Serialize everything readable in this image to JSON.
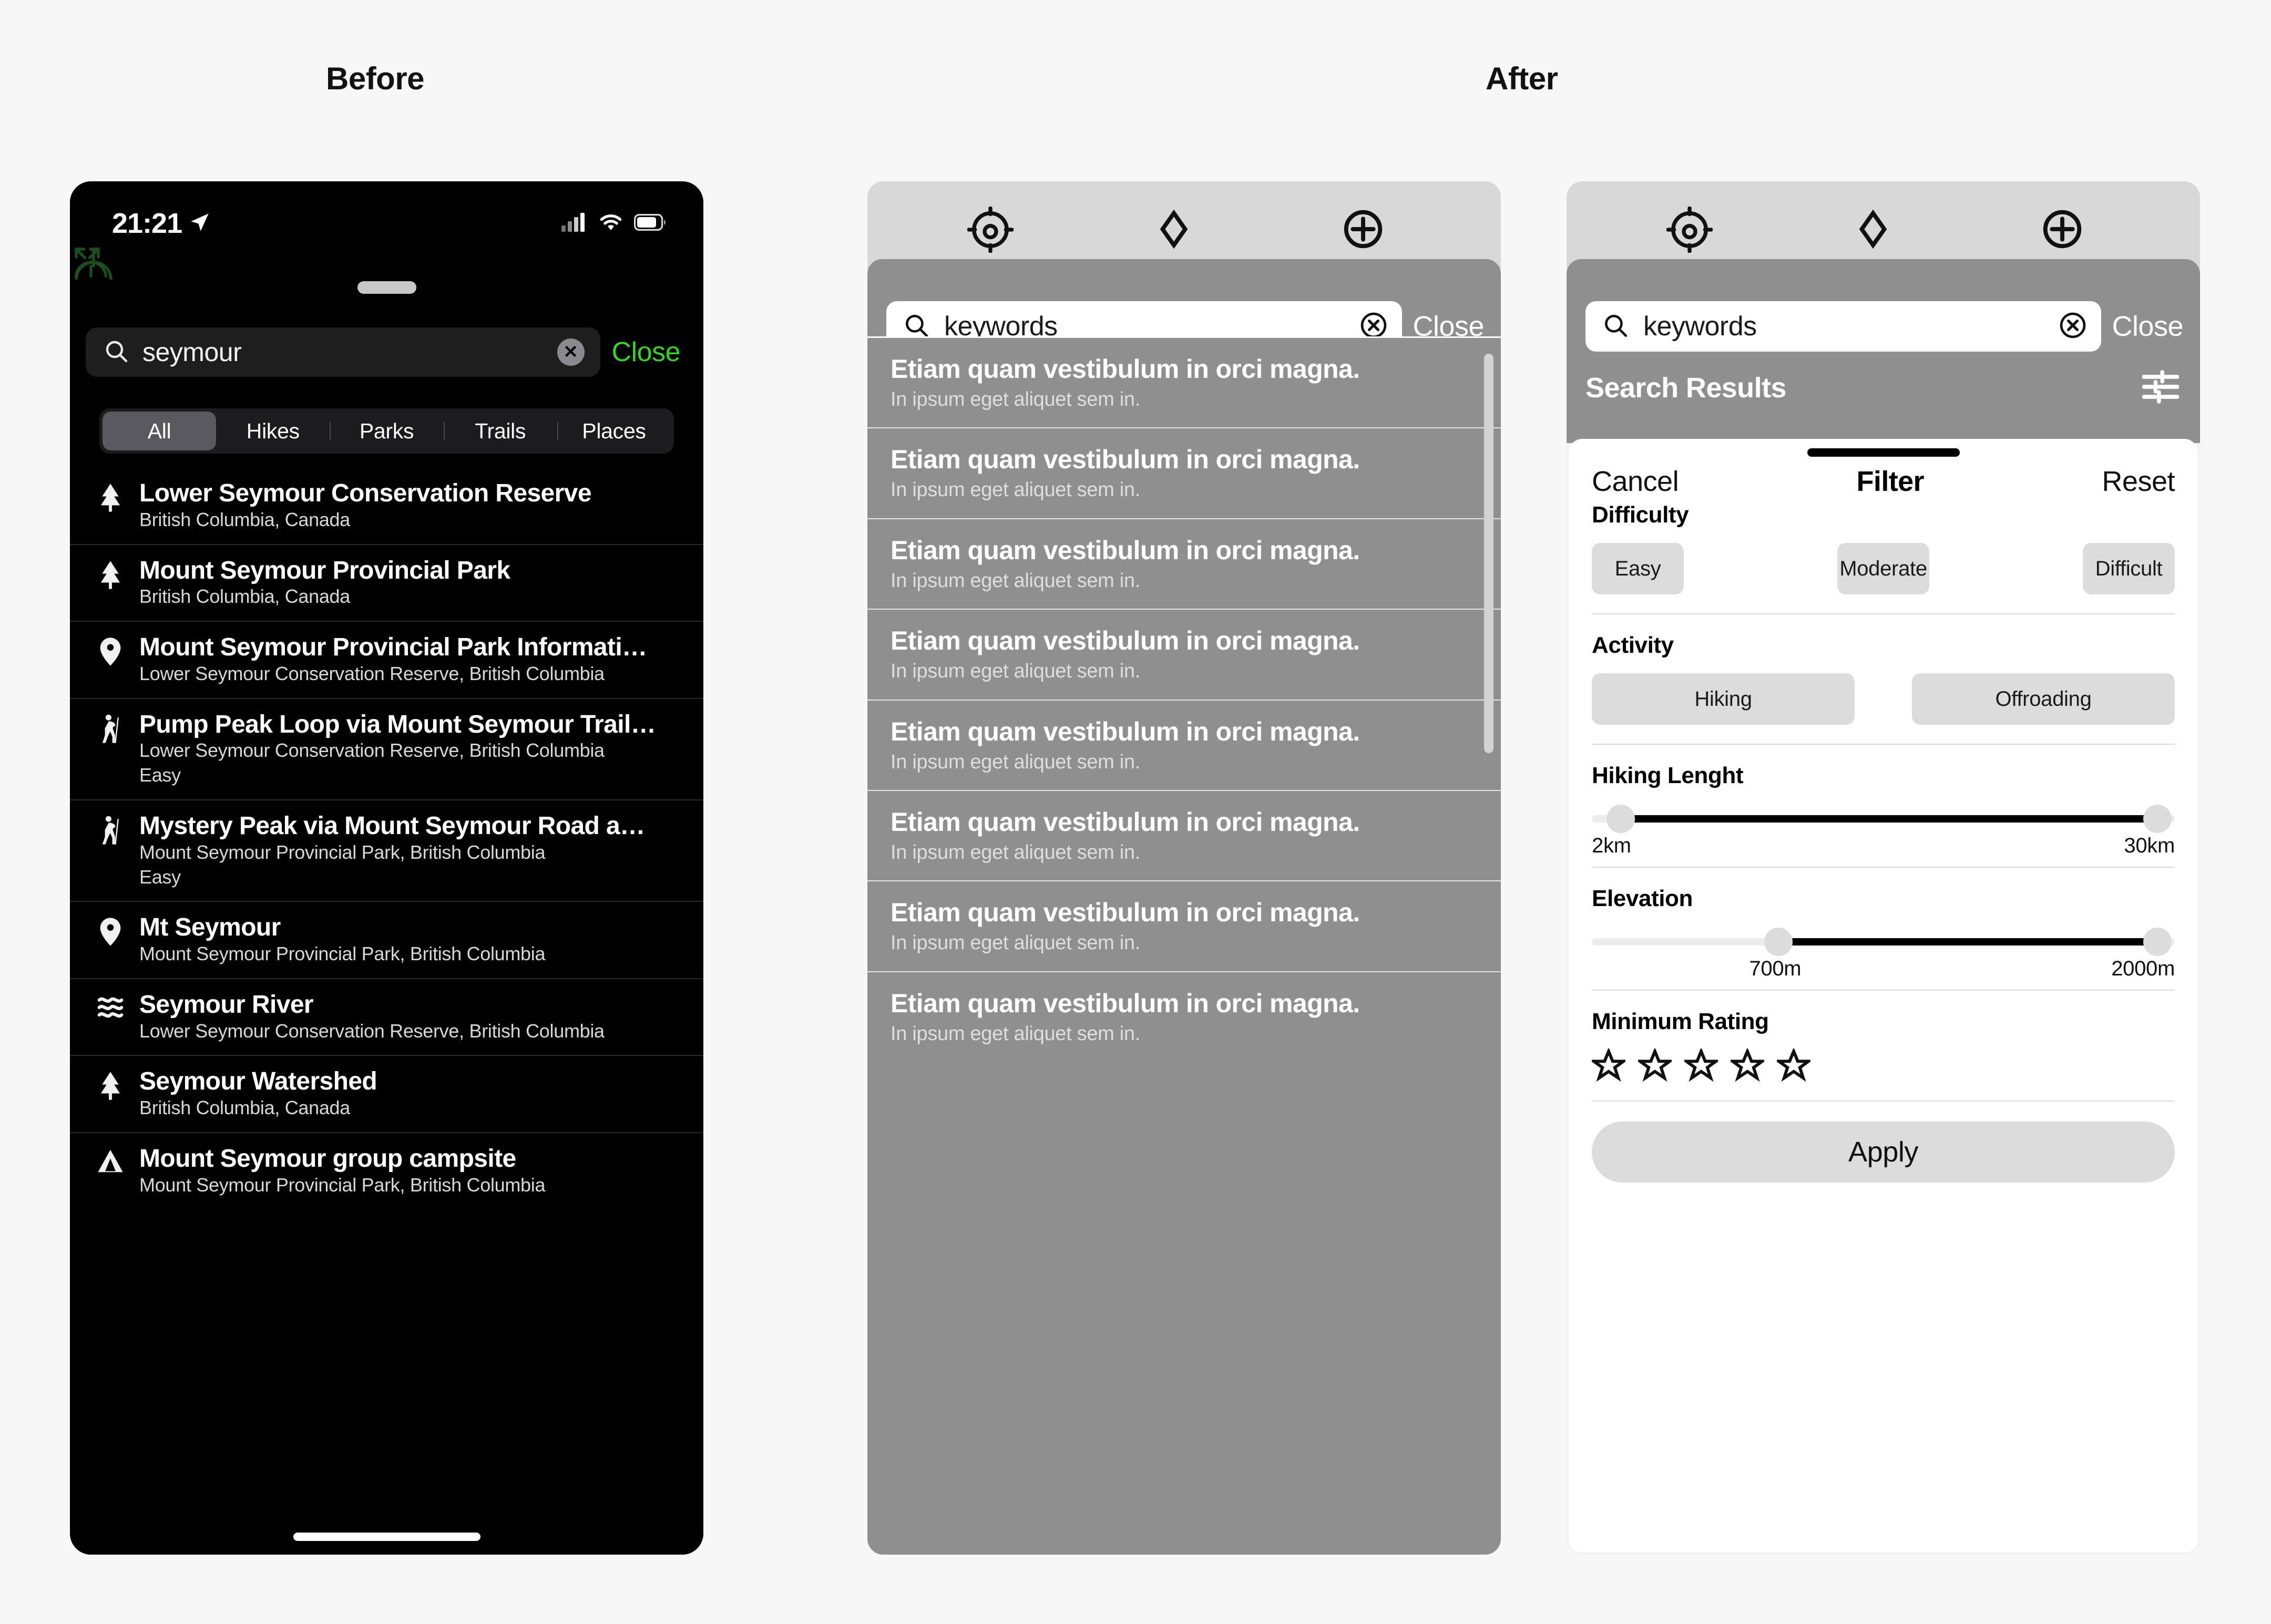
{
  "columns": {
    "before": "Before",
    "after": "After"
  },
  "before_phone": {
    "status_bar": {
      "time": "21:21",
      "location_arrow": "location-arrow-icon",
      "cellular": "cellular-signal-icon",
      "wifi": "wifi-icon",
      "battery": "battery-icon"
    },
    "map_controls": [
      "expand-icon",
      "compass-arc-icon",
      "gauge-arc-icon"
    ],
    "search": {
      "value": "seymour",
      "clear_label": "✕",
      "close_label": "Close",
      "search_icon": "search-icon"
    },
    "segments": [
      {
        "label": "All",
        "active": true
      },
      {
        "label": "Hikes",
        "active": false
      },
      {
        "label": "Parks",
        "active": false
      },
      {
        "label": "Trails",
        "active": false
      },
      {
        "label": "Places",
        "active": false
      }
    ],
    "results": [
      {
        "icon": "tree-icon",
        "title": "Lower Seymour Conservation Reserve",
        "subtitle": "British Columbia, Canada",
        "extra": ""
      },
      {
        "icon": "tree-icon",
        "title": "Mount Seymour Provincial Park",
        "subtitle": "British Columbia, Canada",
        "extra": ""
      },
      {
        "icon": "pin-icon",
        "title": "Mount Seymour Provincial Park Informati…",
        "subtitle": "Lower Seymour Conservation Reserve, British Columbia",
        "extra": ""
      },
      {
        "icon": "hiker-icon",
        "title": "Pump Peak Loop via Mount Seymour Trail…",
        "subtitle": "Lower Seymour Conservation Reserve, British Columbia",
        "extra": "Easy"
      },
      {
        "icon": "hiker-icon",
        "title": "Mystery Peak via Mount Seymour Road a…",
        "subtitle": "Mount Seymour Provincial Park, British Columbia",
        "extra": "Easy"
      },
      {
        "icon": "pin-icon",
        "title": "Mt Seymour",
        "subtitle": "Mount Seymour Provincial Park, British Columbia",
        "extra": ""
      },
      {
        "icon": "waves-icon",
        "title": "Seymour River",
        "subtitle": "Lower Seymour Conservation Reserve, British Columbia",
        "extra": ""
      },
      {
        "icon": "tree-icon",
        "title": "Seymour Watershed",
        "subtitle": "British Columbia, Canada",
        "extra": ""
      },
      {
        "icon": "mountain-icon",
        "title": "Mount Seymour group campsite",
        "subtitle": "Mount Seymour Provincial Park, British Columbia",
        "extra": ""
      }
    ],
    "colors": {
      "accent_close": "#3bd12a",
      "background": "#000000",
      "segment_active": "#5a5a5e"
    }
  },
  "after_panel_results": {
    "map_controls": [
      "locate-crosshair-icon",
      "layers-diamond-icon",
      "add-circle-icon"
    ],
    "search": {
      "value": "keywords",
      "clear_label": "✕",
      "close_label": "Close",
      "search_icon": "search-icon"
    },
    "results_header": {
      "label": "Search Results",
      "filter_icon": "sliders-filter-icon"
    },
    "results": [
      {
        "title": "Etiam quam vestibulum in orci magna.",
        "subtitle": "In ipsum eget aliquet sem in."
      },
      {
        "title": "Etiam quam vestibulum in orci magna.",
        "subtitle": "In ipsum eget aliquet sem in."
      },
      {
        "title": "Etiam quam vestibulum in orci magna.",
        "subtitle": "In ipsum eget aliquet sem in."
      },
      {
        "title": "Etiam quam vestibulum in orci magna.",
        "subtitle": "In ipsum eget aliquet sem in."
      },
      {
        "title": "Etiam quam vestibulum in orci magna.",
        "subtitle": "In ipsum eget aliquet sem in."
      },
      {
        "title": "Etiam quam vestibulum in orci magna.",
        "subtitle": "In ipsum eget aliquet sem in."
      },
      {
        "title": "Etiam quam vestibulum in orci magna.",
        "subtitle": "In ipsum eget aliquet sem in."
      },
      {
        "title": "Etiam quam vestibulum in orci magna.",
        "subtitle": "In ipsum eget aliquet sem in."
      }
    ],
    "colors": {
      "sheet": "#8f8f8f",
      "map": "#d8d8d8",
      "scrollbar": "#d3d3d3"
    }
  },
  "after_panel_filter": {
    "map_controls": [
      "locate-crosshair-icon",
      "layers-diamond-icon",
      "add-circle-icon"
    ],
    "search": {
      "value": "keywords",
      "clear_label": "✕",
      "close_label": "Close",
      "search_icon": "search-icon"
    },
    "results_header": {
      "label": "Search Results",
      "filter_icon": "sliders-filter-icon"
    },
    "filter": {
      "cancel": "Cancel",
      "title": "Filter",
      "reset": "Reset",
      "difficulty": {
        "label": "Difficulty",
        "options": [
          "Easy",
          "Moderate",
          "Difficult"
        ]
      },
      "activity": {
        "label": "Activity",
        "options": [
          "Hiking",
          "Offroading"
        ]
      },
      "hiking_length": {
        "label": "Hiking Lenght",
        "min_label": "2km",
        "max_label": "30km",
        "min_pct": 5,
        "max_pct": 97
      },
      "elevation": {
        "label": "Elevation",
        "min_label": "700m",
        "max_label": "2000m",
        "min_pct": 32,
        "max_pct": 97
      },
      "minimum_rating": {
        "label": "Minimum Rating",
        "stars": 5,
        "filled": 0
      },
      "apply": "Apply"
    },
    "colors": {
      "sheet_bg": "#ffffff",
      "chip_bg": "#dcdcdc",
      "track_on": "#000000",
      "track_off": "#ededed"
    }
  }
}
